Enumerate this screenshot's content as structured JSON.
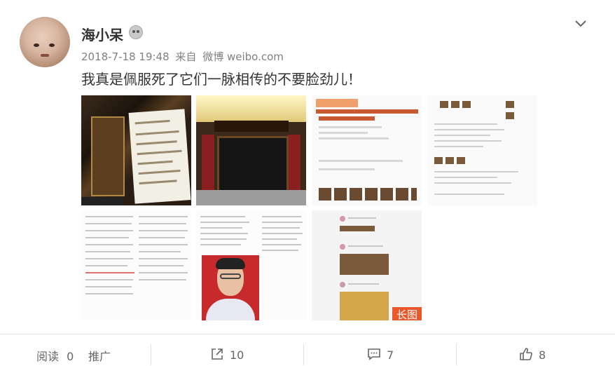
{
  "post": {
    "author": "海小呆",
    "time": "2018-7-18 19:48",
    "source_prefix": "来自",
    "source": "微博 weibo.com",
    "text": "我真是佩服死了它们一脉相传的不要脸劲儿！"
  },
  "images": {
    "long_badge": "长图"
  },
  "footer": {
    "read_label": "阅读",
    "read_count": "0",
    "promote_label": "推广",
    "share_count": "10",
    "comment_count": "7",
    "like_count": "8"
  },
  "colors": {
    "badge": "#e9582b",
    "text": "#333333",
    "meta": "#808080"
  },
  "icons": [
    "verified-badge-icon",
    "chevron-down-icon",
    "share-icon",
    "comment-icon",
    "like-icon"
  ]
}
